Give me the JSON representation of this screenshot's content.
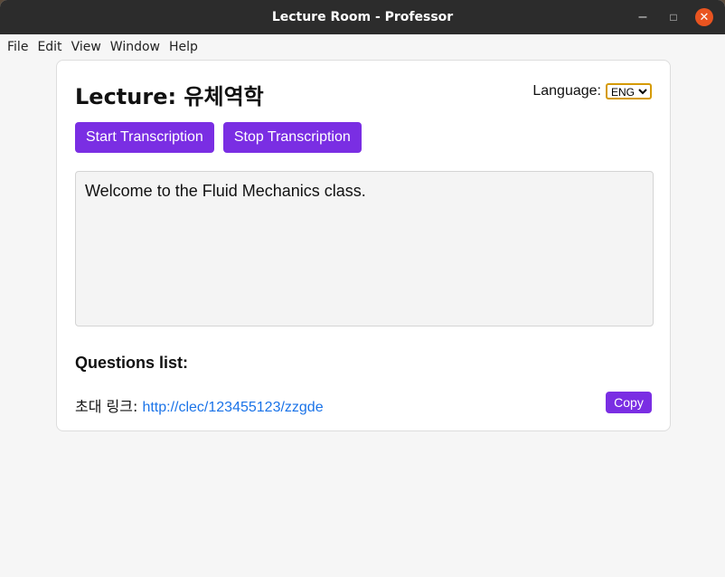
{
  "window": {
    "title": "Lecture Room - Professor",
    "controls": {
      "minimize": "–",
      "maximize": "□",
      "close": "✕"
    }
  },
  "menu": [
    "File",
    "Edit",
    "View",
    "Window",
    "Help"
  ],
  "lecture": {
    "heading": "Lecture: 유체역학",
    "language_label": "Language:",
    "language_value": "ENG",
    "start_button": "Start Transcription",
    "stop_button": "Stop Transcription",
    "transcript": "Welcome to the Fluid Mechanics class.",
    "questions_heading": "Questions list:",
    "invite_label": "초대 링크:",
    "invite_link": "http://clec/123455123/zzgde",
    "copy_button": "Copy"
  },
  "colors": {
    "accent": "#7a2ee3",
    "link": "#1a73e8",
    "titlebar": "#2c2c2c",
    "close": "#e95420"
  }
}
